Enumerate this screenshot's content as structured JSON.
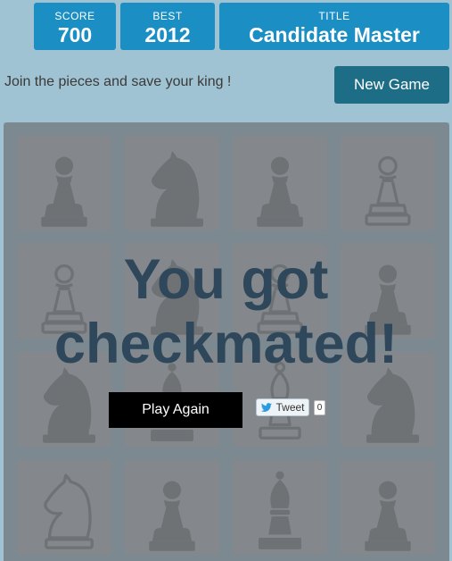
{
  "scores": {
    "score_label": "SCORE",
    "score_value": "700",
    "best_label": "BEST",
    "best_value": "2012",
    "title_label": "TITLE",
    "title_value": "Candidate Master"
  },
  "tagline": "Join the pieces and save your king !",
  "new_game_label": "New Game",
  "board": {
    "rows": [
      [
        "pawn",
        "knight",
        "pawn",
        "pawn-outline"
      ],
      [
        "pawn-outline",
        "knight",
        "pawn-outline",
        "pawn"
      ],
      [
        "knight",
        "bishop",
        "bishop-outline",
        "knight"
      ],
      [
        "knight-outline",
        "pawn",
        "bishop",
        "pawn"
      ]
    ]
  },
  "game_over": {
    "line1": "You got",
    "line2": "checkmated!",
    "play_again_label": "Play Again",
    "tweet_label": "Tweet",
    "tweet_count": "0"
  },
  "colors": {
    "background": "#9fc3d2",
    "score_box": "#1b8fc4",
    "new_game_button": "#1e6d87",
    "message_text": "#2e475a"
  }
}
